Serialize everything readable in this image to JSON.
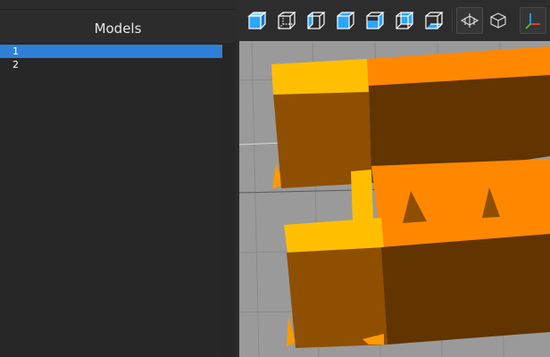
{
  "models_panel": {
    "title": "Models",
    "items": [
      {
        "label": "1",
        "selected": true
      },
      {
        "label": "2",
        "selected": false
      }
    ]
  },
  "toolbar": {
    "buttons": [
      {
        "icon": "cube-solid-front-icon"
      },
      {
        "icon": "cube-wireframe-icon"
      },
      {
        "icon": "cube-left-face-icon"
      },
      {
        "icon": "cube-top-face-icon"
      },
      {
        "icon": "cube-right-face-icon"
      },
      {
        "icon": "cube-back-face-icon"
      },
      {
        "icon": "cube-bottom-face-icon"
      },
      {
        "icon": "perspective-view-icon"
      },
      {
        "icon": "orthographic-view-icon"
      },
      {
        "icon": "axes-icon"
      }
    ]
  },
  "colors": {
    "selection": "#2f7fd6",
    "accent_icon": "#2aa6ff",
    "model_top_yellow": "#ffbf00",
    "model_top_orange": "#ff8800",
    "model_side_brown": "#8b4c00",
    "model_side_dark": "#5f3300",
    "grid": "#9a9a9a"
  }
}
